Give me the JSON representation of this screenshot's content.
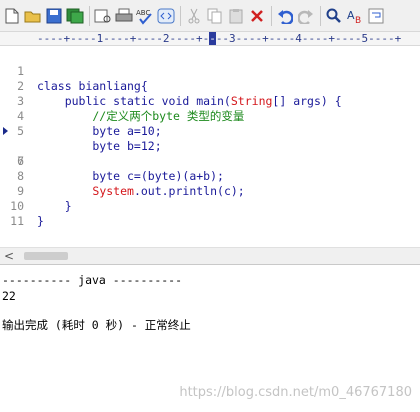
{
  "toolbar": {
    "icons": [
      "new-file-icon",
      "open-folder-icon",
      "save-icon",
      "save-all-icon",
      "print-preview-icon",
      "print-icon",
      "spell-check-icon",
      "html-tag-icon",
      "cut-icon",
      "copy-icon",
      "paste-icon",
      "delete-icon",
      "undo-icon",
      "redo-icon",
      "find-icon",
      "replace-icon",
      "wrap-icon"
    ],
    "spell_label": "ABC"
  },
  "ruler": {
    "before": "----+----1----+----2----+-",
    "cursor": "-",
    "after": "--3----+----4----+----5----+"
  },
  "editor": {
    "line_numbers": [
      "1",
      "2",
      "3",
      "4",
      "5",
      "6",
      "7",
      "8",
      "9",
      "10",
      "11"
    ],
    "lines": {
      "l1": "class bianliang{",
      "l2a": "    public static void main(",
      "l2b": "String",
      "l2c": "[] args) {",
      "l3": "        //定义两个byte 类型的变量",
      "l4": "        byte a=10;",
      "l5": "        byte b=12;",
      "l6": "        byte c=(byte)(a+b);",
      "l8a": "        ",
      "l8b": "System",
      "l8c": ".out.println(c);",
      "l9": "    }",
      "l10": "}"
    },
    "active_line": "6"
  },
  "scrollbar": {
    "left_arrow": "<"
  },
  "output": {
    "header": "---------- java ----------",
    "result": "22",
    "finished": "输出完成 (耗时 0 秒) - 正常终止"
  },
  "watermark": "https://blog.csdn.net/m0_46767180"
}
